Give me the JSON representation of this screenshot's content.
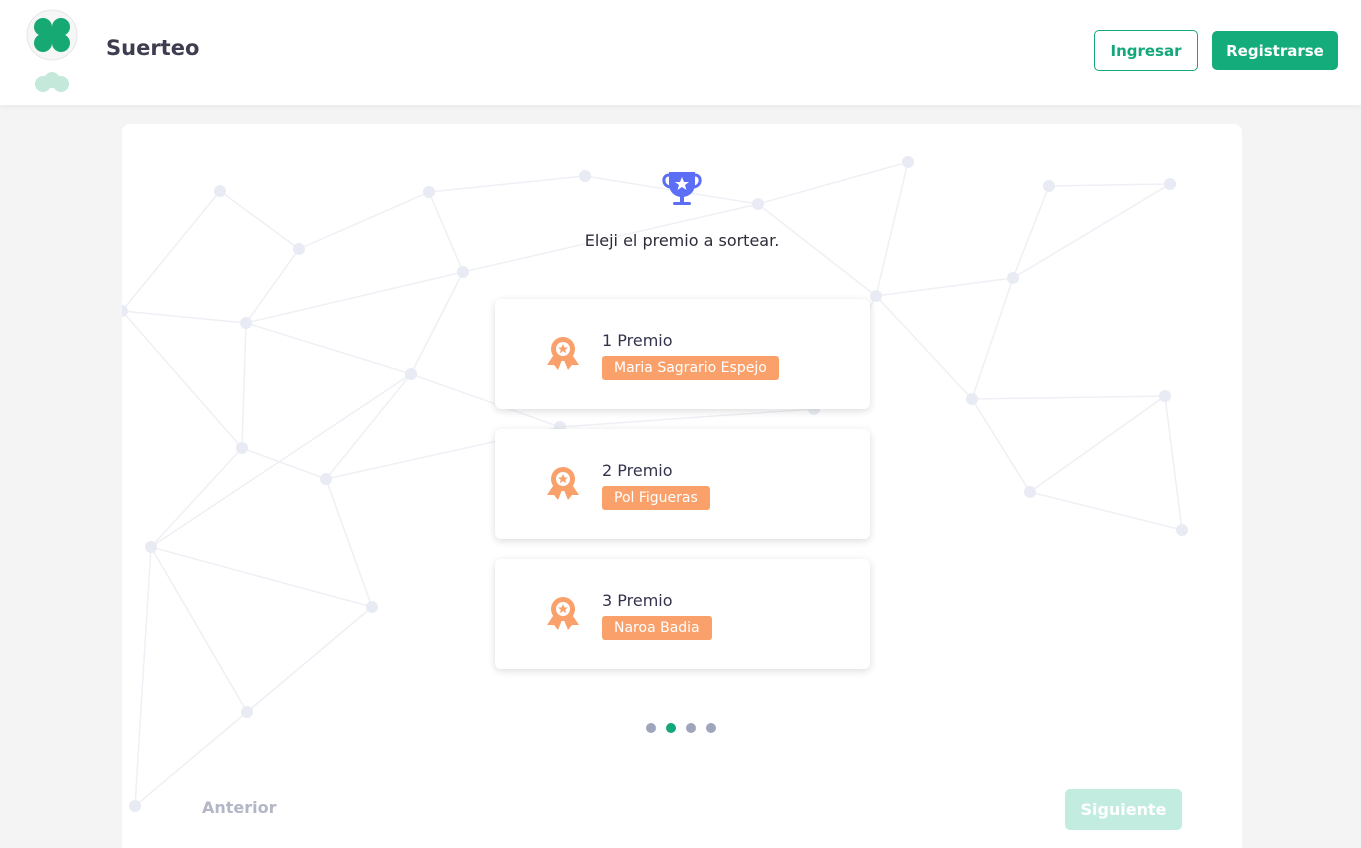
{
  "header": {
    "brand": "Suerteo",
    "login_label": "Ingresar",
    "register_label": "Registrarse"
  },
  "main": {
    "instruction": "Eleji el premio a sortear.",
    "prizes": [
      {
        "title": "1 Premio",
        "winner": "Maria Sagrario Espejo"
      },
      {
        "title": "2 Premio",
        "winner": "Pol Figueras"
      },
      {
        "title": "3 Premio",
        "winner": "Naroa Badia"
      }
    ],
    "pagination": {
      "total": 4,
      "active_index": 2
    },
    "prev_label": "Anterior",
    "next_label": "Siguiente"
  },
  "colors": {
    "brand_green": "#13ac7a",
    "prize_orange": "#f9a06b",
    "trophy_blue": "#5b6ef5"
  },
  "icons": {
    "logo": "clover-icon",
    "header_trophy": "trophy-icon",
    "prize": "award-medal-icon"
  }
}
